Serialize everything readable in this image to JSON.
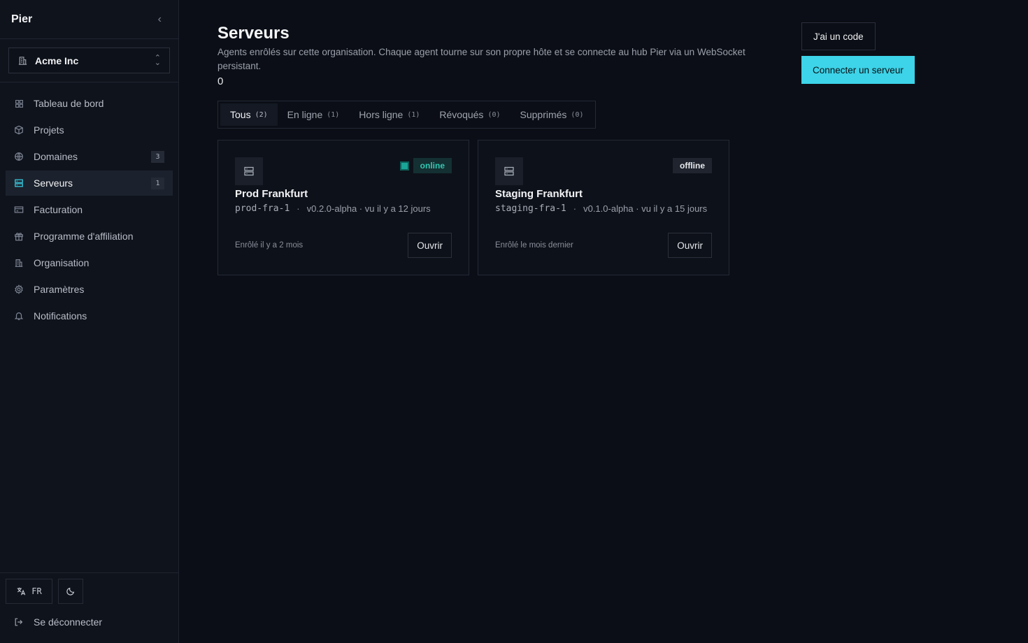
{
  "app": {
    "brand": "Pier"
  },
  "org": {
    "name": "Acme Inc"
  },
  "sidebar": {
    "items": [
      {
        "label": "Tableau de bord",
        "icon": "dashboard-grid-icon"
      },
      {
        "label": "Projets",
        "icon": "box-icon"
      },
      {
        "label": "Domaines",
        "icon": "globe-icon",
        "badge": "3"
      },
      {
        "label": "Serveurs",
        "icon": "server-icon",
        "badge": "1",
        "active": true
      },
      {
        "label": "Facturation",
        "icon": "credit-card-icon"
      },
      {
        "label": "Programme d'affiliation",
        "icon": "gift-icon"
      },
      {
        "label": "Organisation",
        "icon": "building-icon"
      },
      {
        "label": "Paramètres",
        "icon": "gear-icon"
      },
      {
        "label": "Notifications",
        "icon": "bell-icon"
      }
    ],
    "footer": {
      "lang": "FR",
      "logout": "Se déconnecter"
    }
  },
  "page": {
    "title": "Serveurs",
    "subtitle": "Agents enrôlés sur cette organisation. Chaque agent tourne sur son propre hôte et se connecte au hub Pier via un WebSocket persistant.",
    "count": "0",
    "btn_code": "J'ai un code",
    "btn_connect": "Connecter un serveur"
  },
  "tabs": [
    {
      "label": "Tous",
      "count": "(2)",
      "active": true
    },
    {
      "label": "En ligne",
      "count": "(1)"
    },
    {
      "label": "Hors ligne",
      "count": "(1)"
    },
    {
      "label": "Révoqués",
      "count": "(0)"
    },
    {
      "label": "Supprimés",
      "count": "(0)"
    }
  ],
  "servers": [
    {
      "name": "Prod Frankfurt",
      "slug": "prod-fra-1",
      "sep": "·",
      "meta": "v0.2.0-alpha · vu il y a 12 jours",
      "status": "online",
      "enrolled": "Enrôlé il y a 2 mois",
      "open": "Ouvrir"
    },
    {
      "name": "Staging Frankfurt",
      "slug": "staging-fra-1",
      "sep": "·",
      "meta": "v0.1.0-alpha · vu il y a 15 jours",
      "status": "offline",
      "enrolled": "Enrôlé le mois dernier",
      "open": "Ouvrir"
    }
  ],
  "colors": {
    "accent": "#3dd3e8",
    "online": "#30c9b4",
    "background": "#0b0e16"
  }
}
